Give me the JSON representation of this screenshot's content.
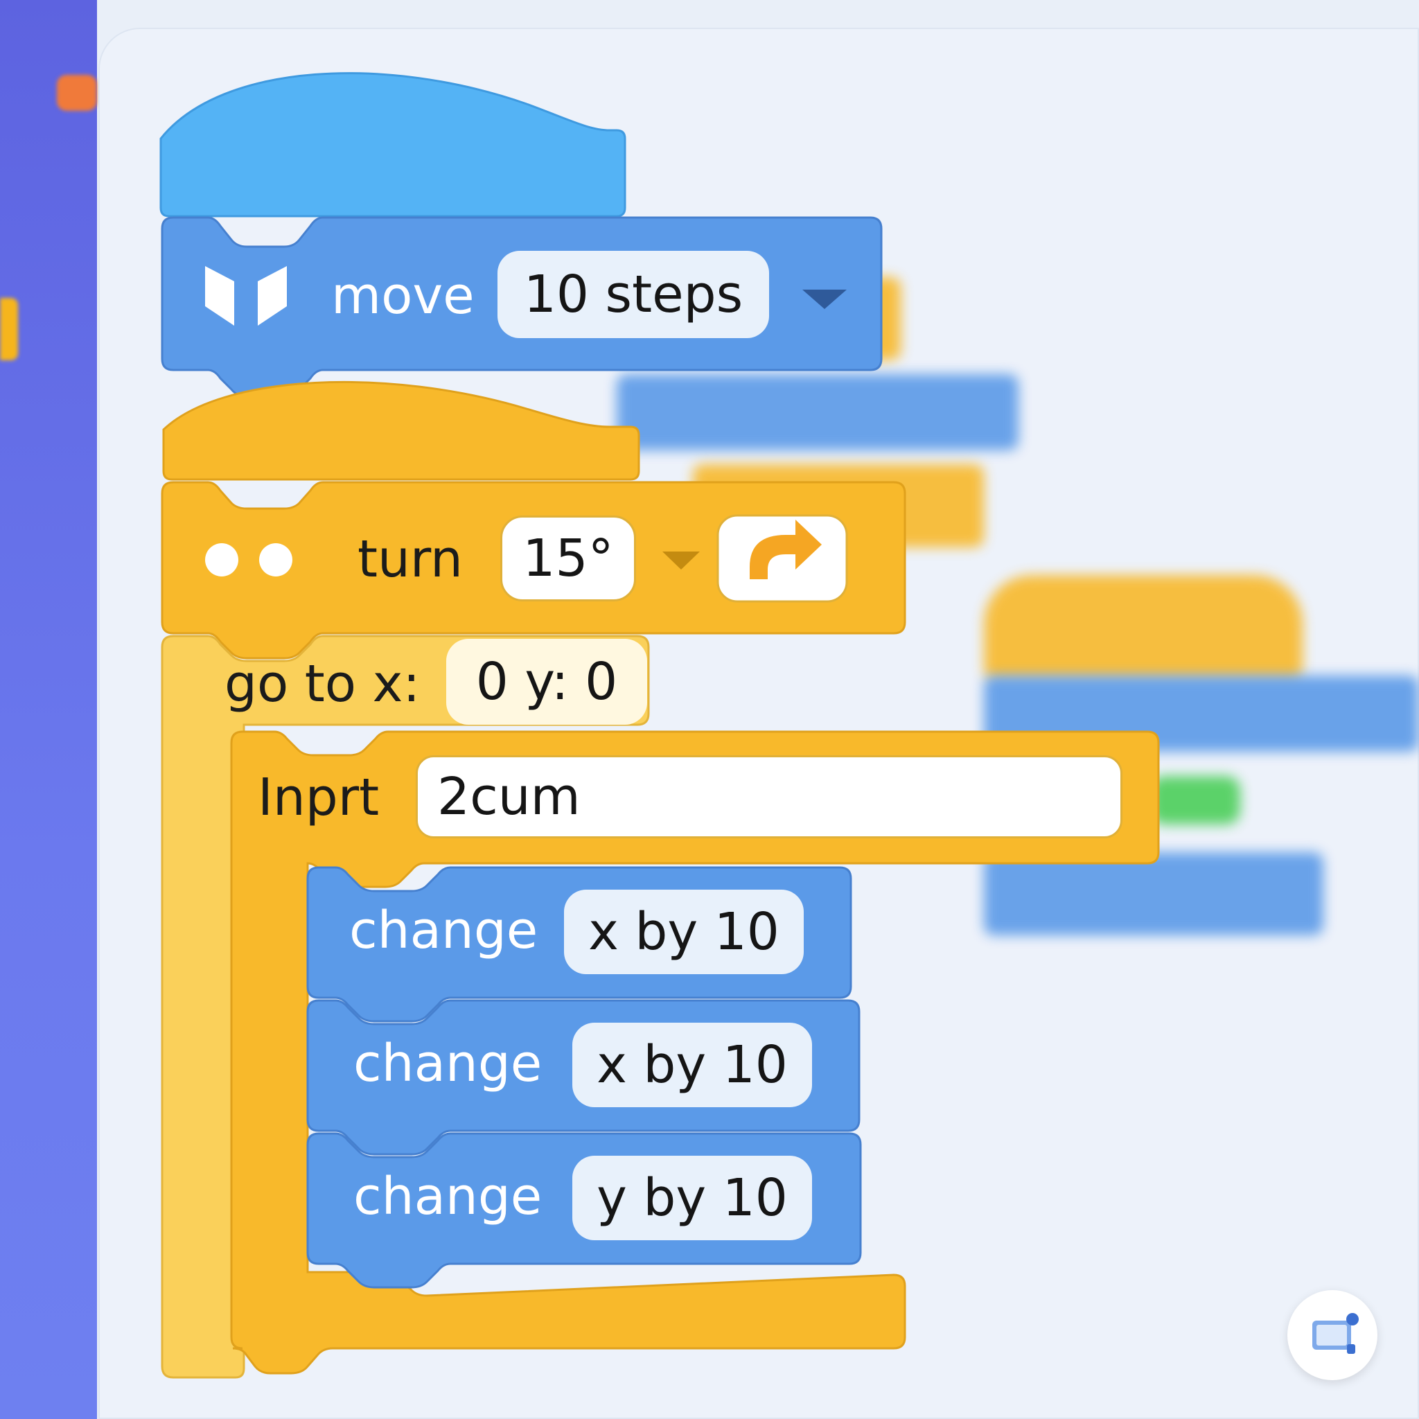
{
  "blocks": {
    "move": {
      "label": "move",
      "value": "10 steps"
    },
    "turn": {
      "label": "turn",
      "value": "15°"
    },
    "goto": {
      "label": "go to x:",
      "value": "0 y: 0"
    },
    "input": {
      "label": "Inprt",
      "value": "2cum"
    },
    "change": [
      {
        "label": "change",
        "value": "x by  10"
      },
      {
        "label": "change",
        "value": "x by  10"
      },
      {
        "label": "change",
        "value": "y by  10"
      }
    ]
  },
  "colors": {
    "blue_block": "#5b9ae8",
    "blue_hat": "#54b3f5",
    "yellow_block": "#f8b92b",
    "sidebar": "#6b79ee",
    "canvas": "#edf2fa"
  },
  "icons": [
    "motion-icon",
    "dots-icon",
    "dropdown-arrow-icon",
    "turn-right-icon",
    "settings-icon"
  ]
}
